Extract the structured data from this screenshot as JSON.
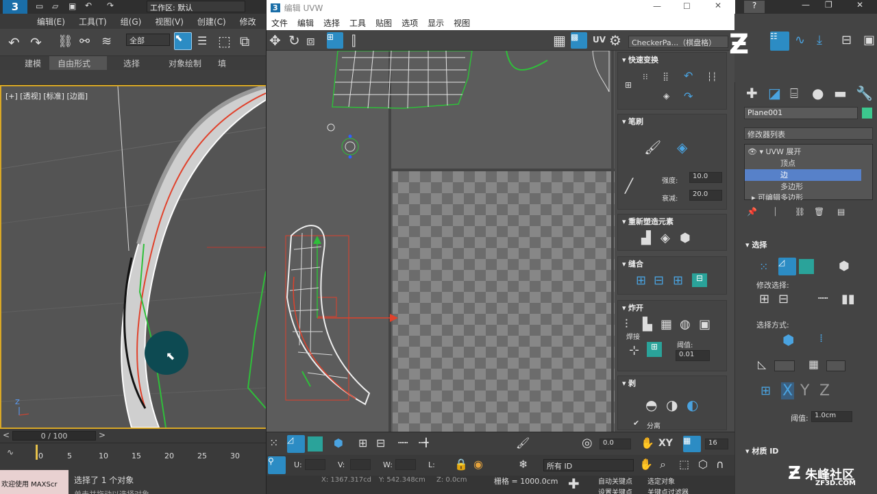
{
  "app": {
    "workspace_label": "工作区: 默认",
    "menu": [
      "编辑(E)",
      "工具(T)",
      "组(G)",
      "视图(V)",
      "创建(C)",
      "修改"
    ],
    "selection_filter": "全部",
    "ribbon_tabs": [
      "建模",
      "自由形式",
      "选择",
      "对象绘制",
      "填"
    ],
    "active_ribbon_tab": "自由形式",
    "viewport_label": "[+] [透视] [标准] [边面]",
    "time_slider": "0 / 100",
    "track_ticks": [
      "0",
      "5",
      "10",
      "15",
      "20",
      "25",
      "30"
    ],
    "status_message": "选择了 1 个对象",
    "maxscript_text": "欢迎使用 MAXScr",
    "prompt_text": "单击并拖动以选择对象"
  },
  "uvw_editor": {
    "title": "编辑 UVW",
    "menu": [
      "文件",
      "编辑",
      "选择",
      "工具",
      "贴图",
      "选项",
      "显示",
      "视图"
    ],
    "uv_label": "UV",
    "checker_selection": "CheckerPa...（棋盘格）",
    "panel": {
      "quick_transform": "快速变换",
      "brush": "笔刷",
      "strength_label": "强度:",
      "strength_value": "10.0",
      "falloff_label": "衰减:",
      "falloff_value": "20.0",
      "reshape_elements": "重新塑造元素",
      "stitch": "缝合",
      "explode": "炸开",
      "weld": "焊接",
      "threshold_label": "阈值:",
      "threshold_value": "0.01",
      "peel": "剥",
      "detach": "分离"
    },
    "bottom": {
      "spin_value": "0.0",
      "xy_label": "XY",
      "grid_count": "16",
      "u_label": "U:",
      "v_label": "V:",
      "w_label": "W:",
      "l_label": "L:",
      "id_filter": "所有 ID",
      "x_coord": "X: 1367.317cd",
      "y_coord": "Y: 542.348cm",
      "z_coord": "Z: 0.0cm",
      "grid_info": "栅格 = 1000.0cm",
      "auto_key": "自动关键点",
      "select_object": "选定对象",
      "set_key": "设置关键点",
      "key_filter": "关键点过滤器"
    }
  },
  "command_panel": {
    "object_name": "Plane001",
    "object_color": "#3cc88e",
    "modifier_list": "修改器列表",
    "stack": [
      "UVW 展开",
      "顶点",
      "边",
      "多边形",
      "可编辑多边形"
    ],
    "selected_stack_index": 2,
    "selection": "选择",
    "modify_selection": "修改选择:",
    "selection_method": "选择方式:",
    "x_label": "X",
    "y_label": "Y",
    "z_label": "Z",
    "threshold_label": "阈值:",
    "threshold_value": "1.0cm",
    "material_id": "材质 ID"
  },
  "watermark": {
    "brand": "朱峰社区",
    "url": "ZF3D.COM"
  },
  "colors": {
    "accent_blue": "#2c8cc4",
    "selection_red": "#e0412b",
    "seam_green": "#2fbf3a",
    "viewport_border": "#d9a826"
  }
}
